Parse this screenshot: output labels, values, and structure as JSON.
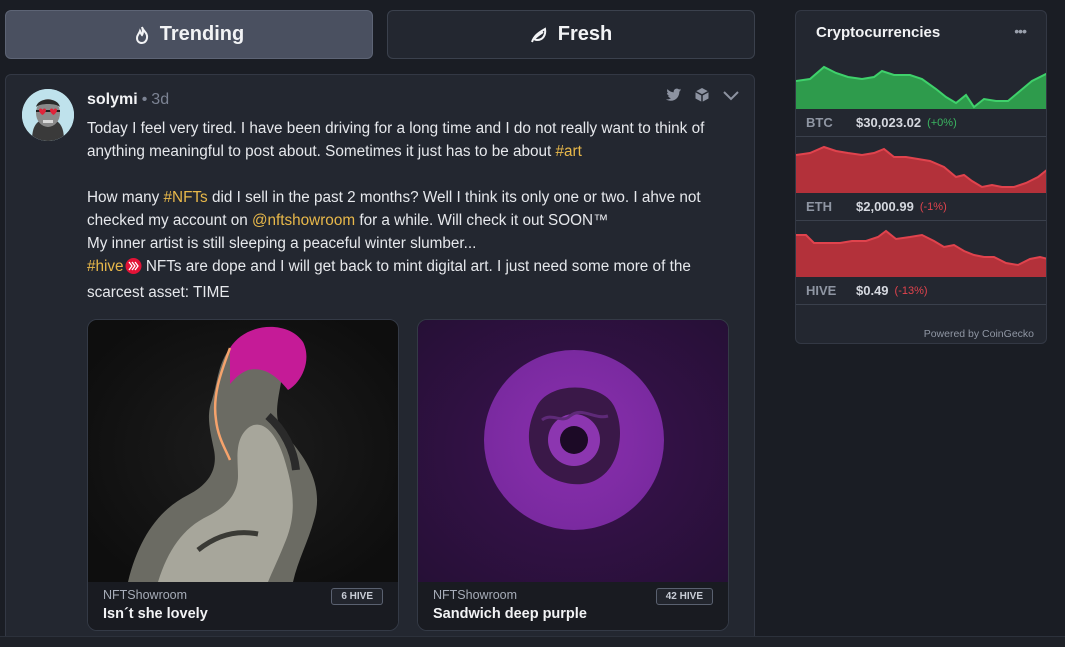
{
  "tabs": [
    {
      "label": "Trending",
      "icon": "flame-icon",
      "active": true
    },
    {
      "label": "Fresh",
      "icon": "leaf-icon",
      "active": false
    }
  ],
  "post": {
    "author": "solymi",
    "separator": "•",
    "age": "3d",
    "para1_text": "Today I feel very tired. I have been driving for a long time and I do not really want to think of anything meaningful to post about. Sometimes it just has to be about ",
    "para1_tag": "#art",
    "line_a_1": "How many ",
    "line_a_tag": "#NFTs",
    "line_a_2": " did I sell in the past 2 months? Well I think its only one or two. I ahve not checked my account on ",
    "line_a_mention": "@nftshowroom",
    "line_a_3": " for a while. Will check it out SOON™",
    "line_b": "My inner artist is still sleeping a peaceful winter slumber...",
    "line_c_tag": "#hive",
    "line_c_text": " NFTs are dope and I will get back to mint digital art. I just need some more of the scarcest asset: TIME",
    "nfts": [
      {
        "source": "NFTShowroom",
        "title": "Isn´t she lovely",
        "price": "6 HIVE"
      },
      {
        "source": "NFTShowroom",
        "title": "Sandwich deep purple",
        "price": "42 HIVE"
      }
    ]
  },
  "widget": {
    "title": "Cryptocurrencies",
    "menu": "•••",
    "coins": [
      {
        "symbol": "BTC",
        "price": "$30,023.02",
        "change": "(+0%)",
        "trend": "up"
      },
      {
        "symbol": "ETH",
        "price": "$2,000.99",
        "change": "(-1%)",
        "trend": "down"
      },
      {
        "symbol": "HIVE",
        "price": "$0.49",
        "change": "(-13%)",
        "trend": "down"
      }
    ],
    "powered": "Powered by CoinGecko"
  },
  "colors": {
    "accent_tag": "#e8b84a",
    "up": "#3bb661",
    "down": "#e0434d",
    "hive_red": "#e31337"
  }
}
